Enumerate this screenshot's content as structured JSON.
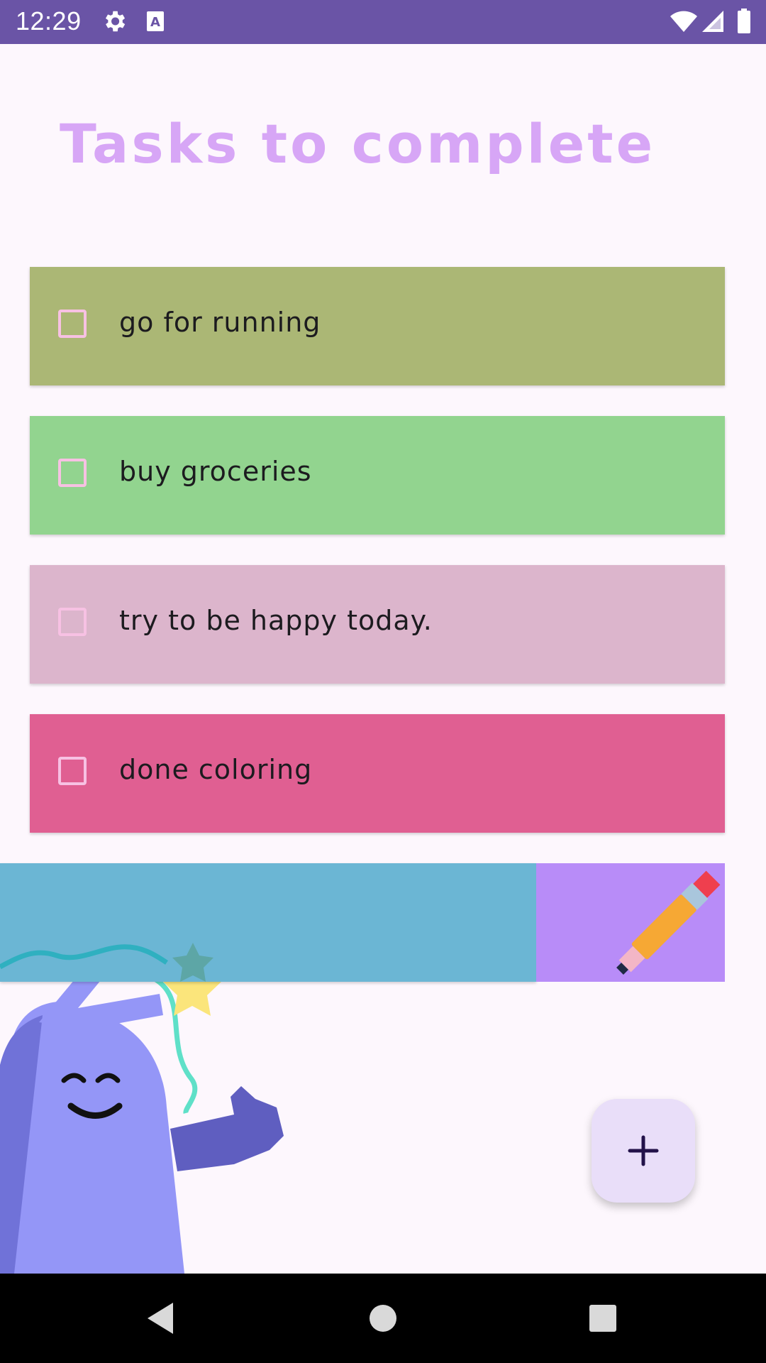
{
  "status_bar": {
    "time": "12:29",
    "icons": [
      "gear-icon",
      "text-a-icon",
      "wifi-icon",
      "signal-icon",
      "battery-icon"
    ]
  },
  "header": {
    "title": "Tasks to complete"
  },
  "tasks": [
    {
      "label": "go for running",
      "color": "#abb775",
      "checked": false
    },
    {
      "label": "buy groceries",
      "color": "#92d48f",
      "checked": false
    },
    {
      "label": "try to be happy today.",
      "color": "#dcb5cc",
      "checked": false
    },
    {
      "label": "done coloring",
      "color": "#e05f92",
      "checked": false
    }
  ],
  "swipe_item": {
    "color": "#6bb6d4",
    "action_icon": "pencil-icon",
    "action_color": "#b88cf8"
  },
  "fab": {
    "icon": "plus-icon"
  },
  "nav_bar": {
    "icons": [
      "back-icon",
      "home-icon",
      "recents-icon"
    ]
  }
}
